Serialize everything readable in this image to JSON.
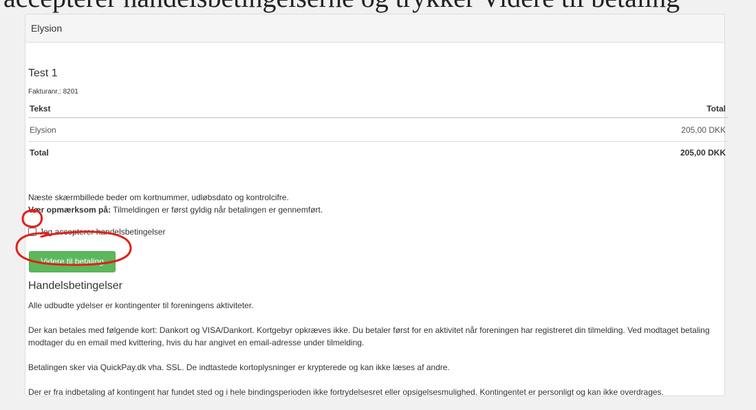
{
  "top_partial_text": "accepterer handelsbetingelserne og trykker Videre til betaling",
  "panel": {
    "heading": "Elysion"
  },
  "invoice": {
    "title": "Test 1",
    "number_label": "Fakturanr.: 8201"
  },
  "table": {
    "headers": [
      "Tekst",
      "Total"
    ],
    "rows": [
      {
        "text": "Elysion",
        "total": "205,00 DKK"
      }
    ],
    "total_row": {
      "label": "Total",
      "value": "205,00 DKK"
    }
  },
  "notes": {
    "line1": "Næste skærmbillede beder om kortnummer, udløbsdato og kontrolcifre.",
    "attention_bold": "Vær opmærksom på:",
    "attention_text": " Tilmeldingen er først gyldig når betalingen er gennemført."
  },
  "accept": {
    "label": "Jeg accepterer handelsbetingelser",
    "checked": false
  },
  "buttons": {
    "continue": "Videre til betaling"
  },
  "terms": {
    "heading": "Handelsbetingelser",
    "p1": "Alle udbudte ydelser er kontingenter til foreningens aktiviteter.",
    "p2": "Der kan betales med følgende kort: Dankort og VISA/Dankort. Kortgebyr opkræves ikke. Du betaler først for en aktivitet når foreningen har registreret din tilmelding. Ved modtaget betaling modtager du en email med kvittering, hvis du har angivet en email-adresse under tilmelding.",
    "p3": "Betalingen sker via QuickPay.dk vha. SSL. De indtastede kortoplysninger er krypterede og kan ikke læses af andre.",
    "p4": "Der er fra indbetaling af kontingent har fundet sted og i hele bindingsperioden ikke fortrydelsesret eller opsigelsesmulighed. Kontingentet er personligt og kan ikke overdrages."
  },
  "colors": {
    "button_bg": "#5cb85c",
    "annotation_red": "#e0201a"
  }
}
